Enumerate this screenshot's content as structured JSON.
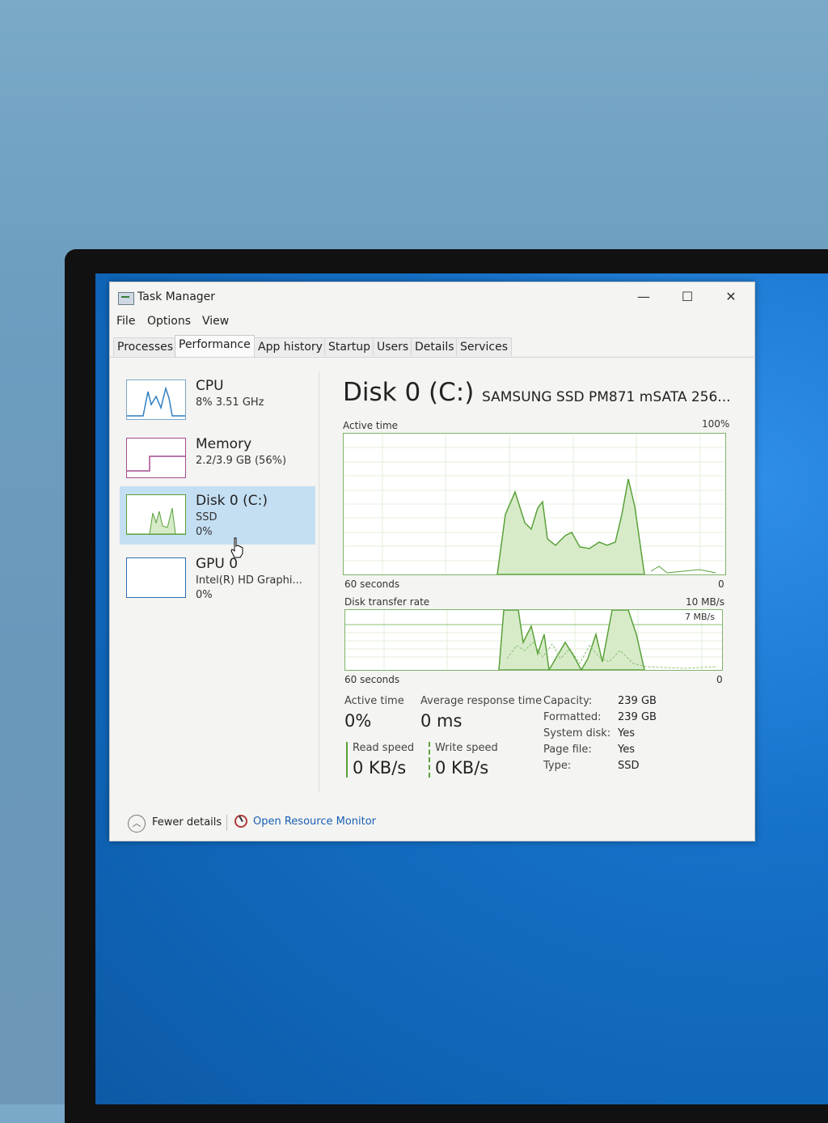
{
  "window": {
    "title": "Task Manager",
    "controls": {
      "minimize": "—",
      "maximize": "☐",
      "close": "✕"
    }
  },
  "menu": [
    "File",
    "Options",
    "View"
  ],
  "tabs": [
    {
      "label": "Processes",
      "active": false
    },
    {
      "label": "Performance",
      "active": true
    },
    {
      "label": "App history",
      "active": false
    },
    {
      "label": "Startup",
      "active": false
    },
    {
      "label": "Users",
      "active": false
    },
    {
      "label": "Details",
      "active": false
    },
    {
      "label": "Services",
      "active": false
    }
  ],
  "sidebar": [
    {
      "name": "CPU",
      "sub": [
        "8% 3.51 GHz"
      ],
      "selected": false
    },
    {
      "name": "Memory",
      "sub": [
        "2.2/3.9 GB (56%)"
      ],
      "selected": false
    },
    {
      "name": "Disk 0 (C:)",
      "sub": [
        "SSD",
        "0%"
      ],
      "selected": true
    },
    {
      "name": "GPU 0",
      "sub": [
        "Intel(R) HD Graphi...",
        "0%"
      ],
      "selected": false
    }
  ],
  "disk": {
    "title": "Disk 0 (C:)",
    "model": "SAMSUNG SSD PM871 mSATA 256...",
    "active_time_graph": {
      "label": "Active time",
      "max_label": "100%",
      "time_label": "60 seconds",
      "min_label": "0"
    },
    "transfer_graph": {
      "label": "Disk transfer rate",
      "max_label": "10 MB/s",
      "inner_label": "7 MB/s",
      "time_label": "60 seconds",
      "min_label": "0"
    },
    "stats": {
      "active_time_label": "Active time",
      "active_time_value": "0%",
      "response_label": "Average response time",
      "response_value": "0 ms",
      "read_label": "Read speed",
      "read_value": "0 KB/s",
      "write_label": "Write speed",
      "write_value": "0 KB/s"
    },
    "info": [
      {
        "key": "Capacity:",
        "value": "239 GB"
      },
      {
        "key": "Formatted:",
        "value": "239 GB"
      },
      {
        "key": "System disk:",
        "value": "Yes"
      },
      {
        "key": "Page file:",
        "value": "Yes"
      },
      {
        "key": "Type:",
        "value": "SSD"
      }
    ]
  },
  "footer": {
    "fewer_details": "Fewer details",
    "resource_monitor": "Open Resource Monitor"
  },
  "colors": {
    "accent_green": "#5aa13a",
    "fill_green": "#d7ebc9",
    "selected_bg": "#c4dff2",
    "link": "#1a5fb4"
  }
}
